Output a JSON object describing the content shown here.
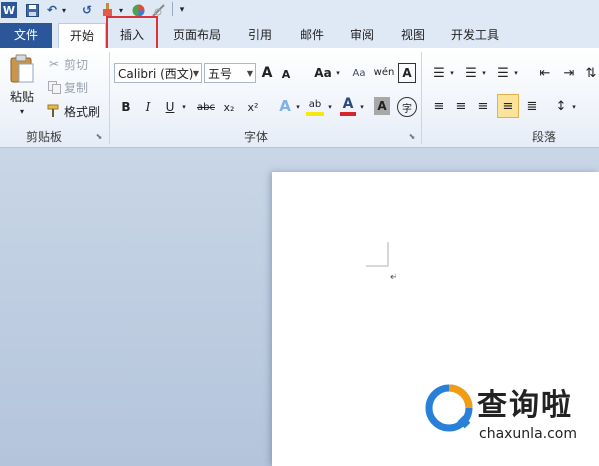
{
  "qat": {
    "word_icon": "W",
    "undo_icon": "↶",
    "redo_icon": "↺"
  },
  "tabs": [
    {
      "label": "文件"
    },
    {
      "label": "开始"
    },
    {
      "label": "插入"
    },
    {
      "label": "页面布局"
    },
    {
      "label": "引用"
    },
    {
      "label": "邮件"
    },
    {
      "label": "审阅"
    },
    {
      "label": "视图"
    },
    {
      "label": "开发工具"
    }
  ],
  "clipboard": {
    "paste": "粘贴",
    "cut": "剪切",
    "copy": "复制",
    "format_painter": "格式刷",
    "group": "剪贴板"
  },
  "font": {
    "name": "Calibri (西文)",
    "size": "五号",
    "group": "字体",
    "bold": "B",
    "italic": "I",
    "underline": "U",
    "strike": "abc",
    "sub": "x₂",
    "sup": "x²",
    "grow": "A",
    "shrink": "A",
    "case": "Aa",
    "phonetic": "wén",
    "charborder": "A",
    "charshade": "A",
    "enclose": "字"
  },
  "paragraph": {
    "group": "段落"
  },
  "watermark": {
    "title": "查询啦",
    "url": "chaxunla.com"
  },
  "colors": {
    "accent": "#2b579a",
    "highlight_box": "#d9343a",
    "brand_orange": "#f39c12",
    "brand_blue": "#2980d9"
  }
}
